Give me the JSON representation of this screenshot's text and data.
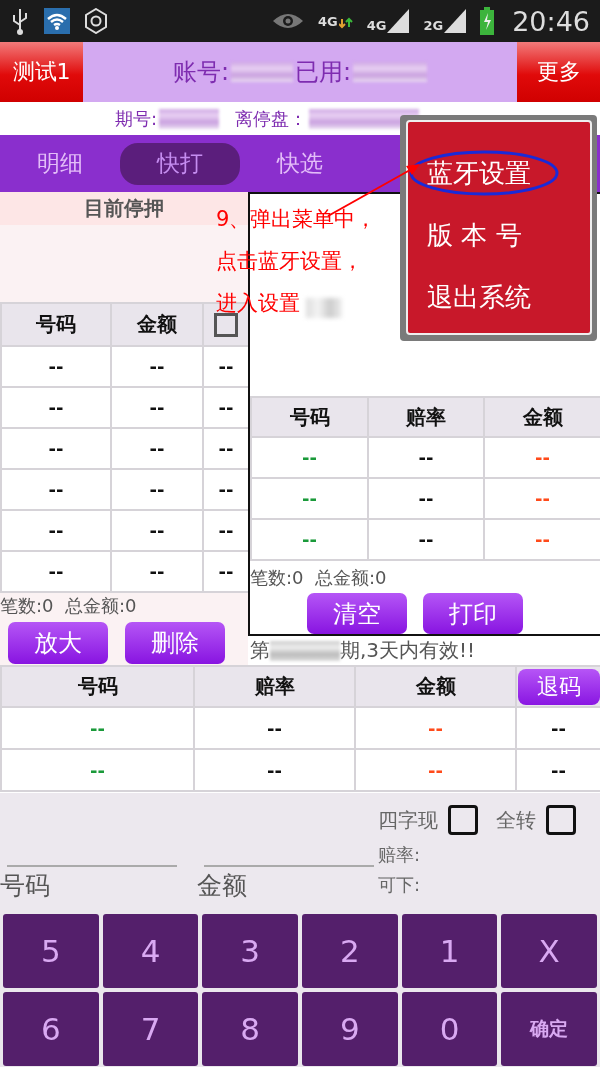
{
  "status_bar": {
    "network_labels": [
      "4G",
      "4G",
      "2G"
    ],
    "time": "20:46"
  },
  "header": {
    "left_button": "测试1",
    "account_label": "账号:",
    "used_label": "已用:",
    "right_button": "更多"
  },
  "info": {
    "period_label": "期号:",
    "close_label": "离停盘："
  },
  "tabs": [
    {
      "label": "明细",
      "selected": false
    },
    {
      "label": "快打",
      "selected": true
    },
    {
      "label": "快选",
      "selected": false
    }
  ],
  "current_bets": {
    "title": "目前停押",
    "columns": [
      "号码",
      "金额"
    ],
    "select_all_checked": false,
    "rows": [
      [
        "--",
        "--",
        "--"
      ],
      [
        "--",
        "--",
        "--"
      ],
      [
        "--",
        "--",
        "--"
      ],
      [
        "--",
        "--",
        "--"
      ],
      [
        "--",
        "--",
        "--"
      ],
      [
        "--",
        "--",
        "--"
      ]
    ],
    "summary": "笔数:0  总金额:0",
    "buttons": [
      "放大",
      "删除"
    ]
  },
  "quick_panel": {
    "columns": [
      "号码",
      "赔率",
      "金额"
    ],
    "rows": [
      [
        "--",
        "--",
        "--"
      ],
      [
        "--",
        "--",
        "--"
      ],
      [
        "--",
        "--",
        "--"
      ]
    ],
    "summary": "笔数:0  总金额:0",
    "buttons": [
      "清空",
      "打印"
    ]
  },
  "validity": {
    "prefix": "第",
    "suffix": "期,3天内有效!!"
  },
  "bet_table": {
    "columns": [
      "号码",
      "赔率",
      "金额"
    ],
    "refund_button": "退码",
    "rows": [
      [
        "--",
        "--",
        "--",
        "--"
      ],
      [
        "--",
        "--",
        "--",
        "--"
      ]
    ]
  },
  "options": [
    {
      "label": "四字现",
      "checked": false
    },
    {
      "label": "全转",
      "checked": false
    }
  ],
  "fields": [
    {
      "label": "号码"
    },
    {
      "label": "金额"
    }
  ],
  "odds_label": "赔率:",
  "available_label": "可下:",
  "keypad": [
    {
      "label": "5",
      "kind": "key"
    },
    {
      "label": "4",
      "kind": "key"
    },
    {
      "label": "3",
      "kind": "key"
    },
    {
      "label": "2",
      "kind": "key"
    },
    {
      "label": "1",
      "kind": "key"
    },
    {
      "label": "X",
      "kind": "key"
    },
    {
      "label": "6",
      "kind": "key"
    },
    {
      "label": "7",
      "kind": "key"
    },
    {
      "label": "8",
      "kind": "key"
    },
    {
      "label": "9",
      "kind": "key"
    },
    {
      "label": "0",
      "kind": "key"
    },
    {
      "label": "确定",
      "kind": "confirm"
    }
  ],
  "menu": {
    "items": [
      {
        "label": "蓝牙设置",
        "circled": true
      },
      {
        "label": "版 本 号",
        "circled": false
      },
      {
        "label": "退出系统",
        "circled": false
      }
    ]
  },
  "annotation": {
    "lines": [
      "9、弹出菜单中，",
      "点击蓝牙设置，",
      "进入设置"
    ]
  }
}
